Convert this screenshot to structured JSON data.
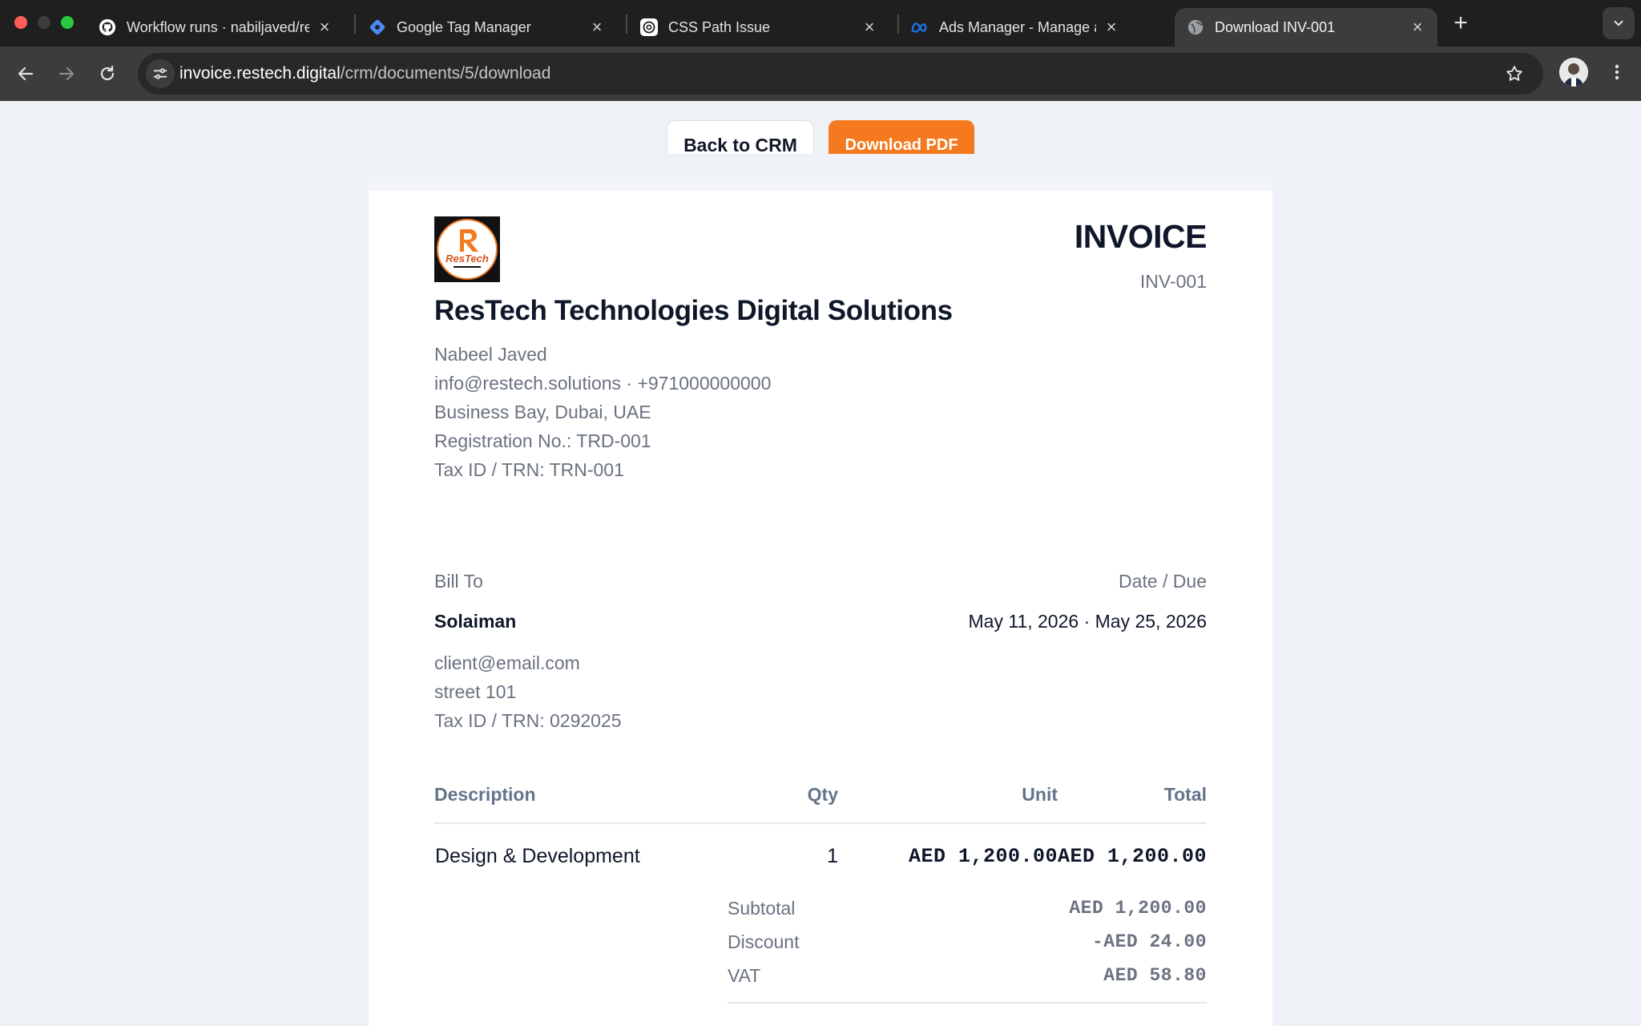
{
  "browser": {
    "tabs": [
      {
        "title": "Workflow runs · nabiljaved/re",
        "icon": "github-icon"
      },
      {
        "title": "Google Tag Manager",
        "icon": "gtm-icon"
      },
      {
        "title": "CSS Path Issue",
        "icon": "openai-icon"
      },
      {
        "title": "Ads Manager - Manage ads -",
        "icon": "meta-icon"
      },
      {
        "title": "Download INV-001",
        "icon": "globe-icon",
        "active": true
      }
    ],
    "address": {
      "host": "invoice.restech.digital",
      "path": "/crm/documents/5/download"
    }
  },
  "actions": {
    "back_label": "Back to CRM",
    "download_label": "Download PDF",
    "download_color": "#f4791f"
  },
  "invoice": {
    "logo_text": "ResTech",
    "title": "INVOICE",
    "number": "INV-001",
    "seller": {
      "company": "ResTech Technologies Digital Solutions",
      "contact": "Nabeel Javed",
      "email_phone": "info@restech.solutions · +971000000000",
      "address": "Business Bay, Dubai, UAE",
      "registration": "Registration No.: TRD-001",
      "tax_id": "Tax ID / TRN: TRN-001"
    },
    "bill_to_label": "Bill To",
    "date_due_label": "Date / Due",
    "client": {
      "name": "Solaiman",
      "email": "client@email.com",
      "address": "street 101",
      "tax_id": "Tax ID / TRN: 0292025"
    },
    "dates": "May 11, 2026 · May 25, 2026",
    "table": {
      "headers": {
        "description": "Description",
        "qty": "Qty",
        "unit": "Unit",
        "total": "Total"
      },
      "rows": [
        {
          "description": "Design & Development",
          "qty": "1",
          "unit": "AED 1,200.00",
          "total": "AED 1,200.00"
        }
      ]
    },
    "summary": [
      {
        "label": "Subtotal",
        "value": "AED 1,200.00"
      },
      {
        "label": "Discount",
        "value": "-AED 24.00"
      },
      {
        "label": "VAT",
        "value": "AED 58.80"
      }
    ]
  }
}
